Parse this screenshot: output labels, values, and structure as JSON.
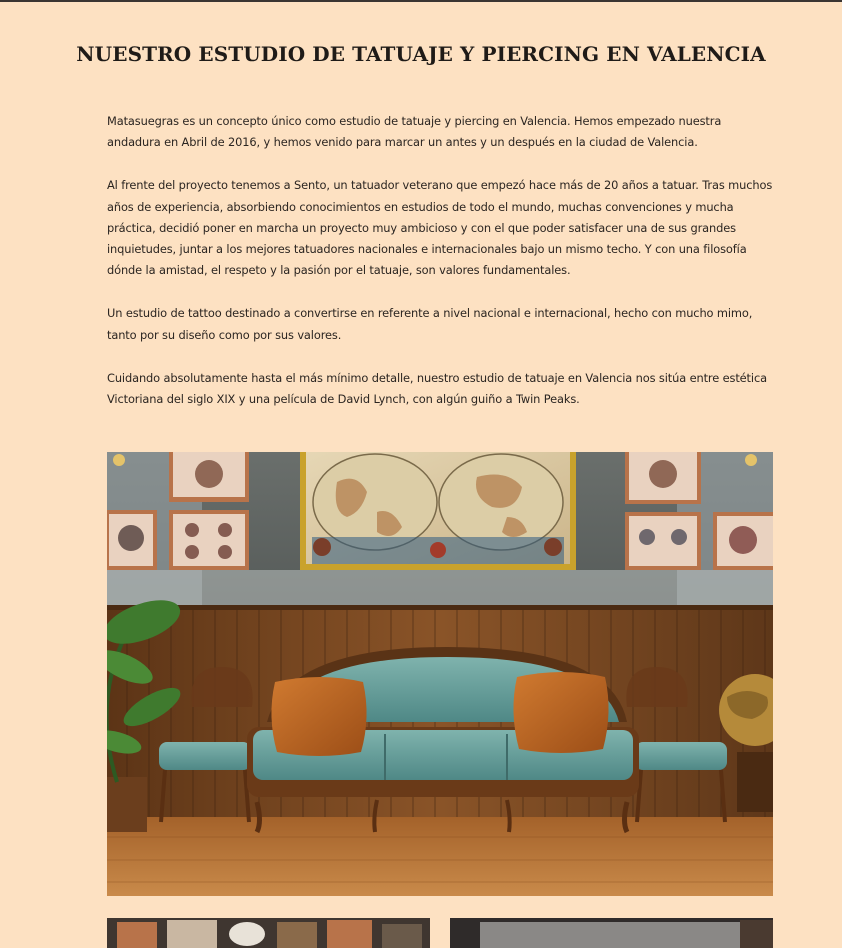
{
  "page": {
    "title": "NUESTRO ESTUDIO DE TATUAJE Y PIERCING EN VALENCIA",
    "paragraphs": [
      "Matasuegras es un concepto único como estudio de tatuaje y piercing en Valencia. Hemos empezado nuestra andadura en Abril de 2016, y hemos venido para marcar un antes y un después en la ciudad de Valencia.",
      "Al frente del proyecto tenemos a Sento, un tatuador veterano que empezó hace más de 20 años a tatuar. Tras muchos años de experiencia, absorbiendo conocimientos en estudios de todo el mundo, muchas convenciones y mucha práctica, decidió poner en marcha un proyecto muy ambicioso y con el que poder satisfacer una de sus grandes inquietudes, juntar a los mejores tatuadores nacionales e internacionales bajo un mismo techo. Y con una filosofía dónde la amistad, el respeto y la pasión por el tatuaje, son valores fundamentales.",
      "Un estudio de tattoo destinado a convertirse en referente a nivel nacional e internacional, hecho con mucho mimo, tanto por su diseño como por sus valores.",
      "Cuidando absolutamente hasta el más mínimo detalle, nuestro estudio de tatuaje en Valencia nos sitúa entre estética Victoriana del siglo XIX y una película de David Lynch, con algún guiño a Twin Peaks."
    ]
  },
  "colors": {
    "background": "#fde1c2",
    "text": "#2b2521",
    "title": "#1f1b18",
    "wall_gray": "#5f6461",
    "wood": "#7a4a22",
    "sofa_teal": "#5a9a98",
    "cushion": "#b8611f"
  }
}
